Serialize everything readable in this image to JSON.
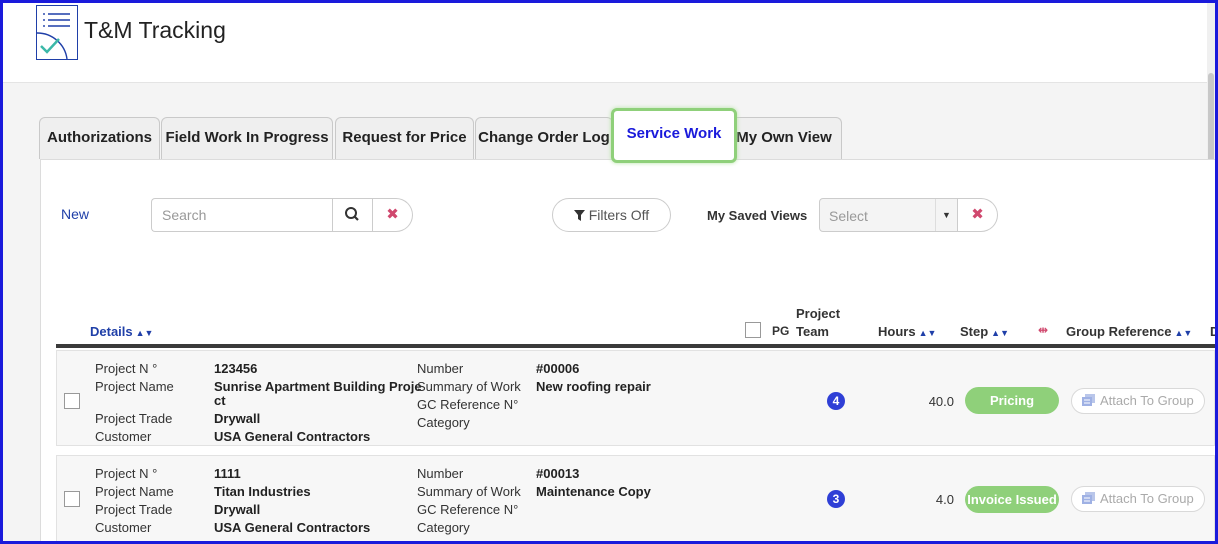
{
  "app": {
    "title": "T&M Tracking"
  },
  "tabs": [
    {
      "label": "Authorizations"
    },
    {
      "label": "Field Work In Progress"
    },
    {
      "label": "Request for Price"
    },
    {
      "label": "Change Order Log"
    },
    {
      "label": "Service Work",
      "active": true
    },
    {
      "label": "My Own View"
    }
  ],
  "toolbar": {
    "new_label": "New",
    "search_placeholder": "Search",
    "filters_label": "Filters Off",
    "saved_views_label": "My Saved Views",
    "saved_views_select": "Select"
  },
  "columns": {
    "details": "Details",
    "pg": "PG",
    "project_team_1": "Project",
    "project_team_2": "Team",
    "hours": "Hours",
    "step": "Step",
    "group_reference": "Group Reference",
    "next": "D"
  },
  "colors": {
    "accent": "#1a1adb",
    "step_green": "#8fd07a",
    "badge_blue": "#2f3fd6",
    "clear_red": "#d0486e"
  },
  "rows": [
    {
      "labels": {
        "project_no": "Project N °",
        "project_name": "Project Name",
        "project_trade": "Project Trade",
        "customer": "Customer",
        "number": "Number",
        "summary": "Summary of Work",
        "gc_ref": "GC Reference N°",
        "category": "Category"
      },
      "project_no": "123456",
      "project_name_1": "Sunrise Apartment Building Proje",
      "project_name_2": "ct",
      "project_trade": "Drywall",
      "customer": "USA General Contractors",
      "number": "#00006",
      "summary": "New roofing repair",
      "team": "4",
      "hours": "40.0",
      "step": "Pricing",
      "attach": "Attach To Group"
    },
    {
      "labels": {
        "project_no": "Project N °",
        "project_name": "Project Name",
        "project_trade": "Project Trade",
        "customer": "Customer",
        "number": "Number",
        "summary": "Summary of Work",
        "gc_ref": "GC Reference N°",
        "category": "Category"
      },
      "project_no": "1111",
      "project_name_1": "Titan Industries",
      "project_trade": "Drywall",
      "customer": "USA General Contractors",
      "number": "#00013",
      "summary": "Maintenance Copy",
      "team": "3",
      "hours": "4.0",
      "step": "Invoice Issued",
      "attach": "Attach To Group"
    }
  ]
}
